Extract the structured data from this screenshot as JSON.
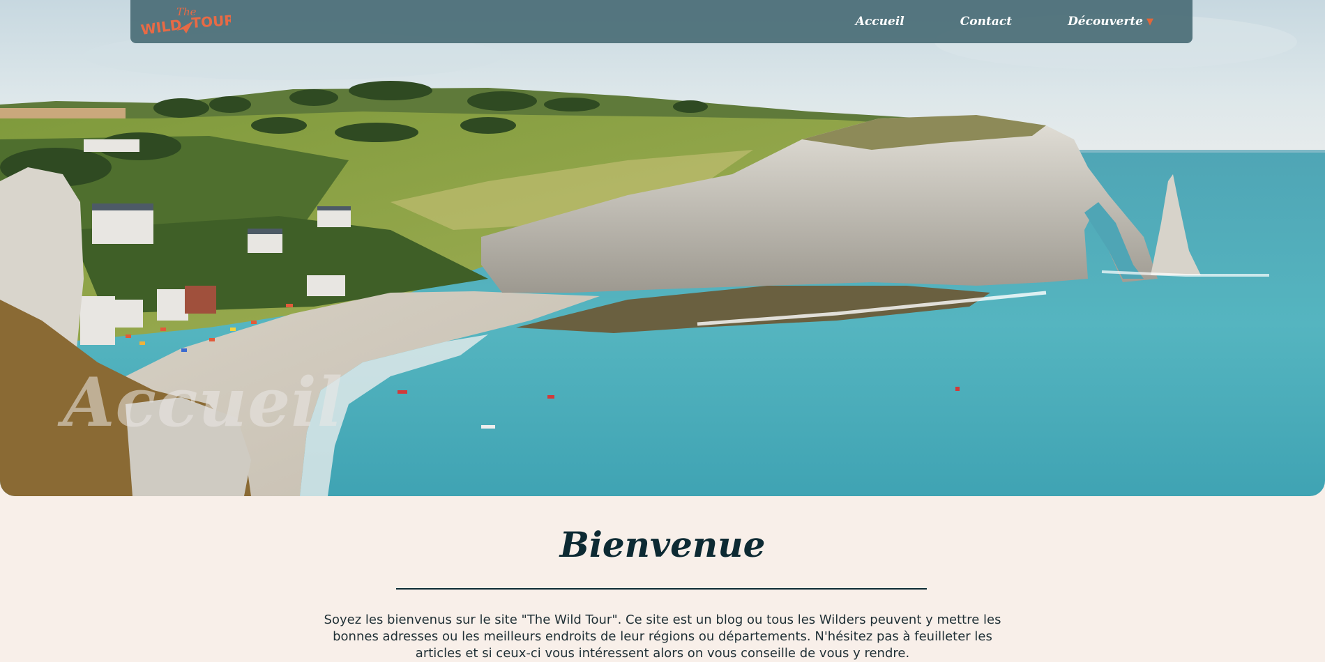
{
  "brand": {
    "logo_the": "The",
    "logo_wild": "WILD",
    "logo_tour": "TOUR",
    "colors": {
      "logo": "#e86a45",
      "accent": "#e2673a",
      "navbar": "#4a6c76",
      "heading": "#0d2a33",
      "background": "#f8efe9"
    }
  },
  "nav": {
    "accueil": "Accueil",
    "contact": "Contact",
    "decouverte": "Découverte",
    "dropdown_icon": "triangle-down-icon"
  },
  "hero": {
    "title": "Accueil"
  },
  "main": {
    "heading": "Bienvenue",
    "intro": "Soyez les bienvenus sur le site \"The Wild Tour\". Ce site est un blog ou tous les Wilders peuvent y mettre les bonnes adresses ou les meilleurs endroits de leur régions ou départements. N'hésitez pas à feuilleter les articles et si ceux-ci vous intéressent alors on vous conseille de vous y rendre."
  }
}
